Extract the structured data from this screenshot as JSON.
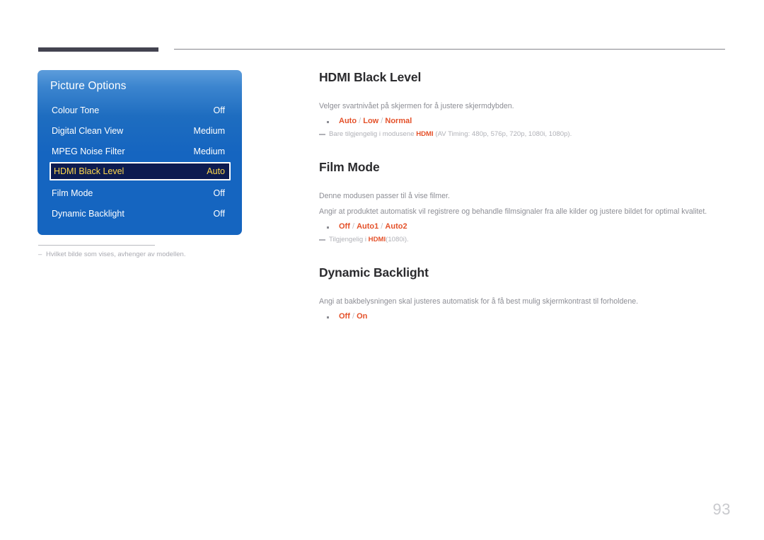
{
  "page": {
    "number": "93",
    "left_footnote": "Hvilket bilde som vises, avhenger av modellen."
  },
  "osd_menu": {
    "title": "Picture Options",
    "rows": [
      {
        "label": "Colour Tone",
        "value": "Off",
        "selected": false
      },
      {
        "label": "Digital Clean View",
        "value": "Medium",
        "selected": false
      },
      {
        "label": "MPEG Noise Filter",
        "value": "Medium",
        "selected": false
      },
      {
        "label": "HDMI Black Level",
        "value": "Auto",
        "selected": true
      },
      {
        "label": "Film Mode",
        "value": "Off",
        "selected": false
      },
      {
        "label": "Dynamic Backlight",
        "value": "Off",
        "selected": false
      }
    ],
    "colors": {
      "panel_blue": "#1565c0",
      "selected_bg": "#0d1b50",
      "selected_text": "#ffd84d"
    }
  },
  "sections": {
    "hdmi_black_level": {
      "heading": "HDMI Black Level",
      "body": "Velger svartnivået på skjermen for å justere skjermdybden.",
      "options": {
        "o1": "Auto",
        "o2": "Low",
        "o3": "Normal"
      },
      "note_pre": "Bare tilgjengelig i modusene ",
      "note_hl": "HDMI",
      "note_post": " (AV Timing: 480p, 576p, 720p, 1080i, 1080p)."
    },
    "film_mode": {
      "heading": "Film Mode",
      "body1": "Denne modusen passer til å vise filmer.",
      "body2": "Angir at produktet automatisk vil registrere og behandle filmsignaler fra alle kilder og justere bildet for optimal kvalitet.",
      "options": {
        "o1": "Off",
        "o2": "Auto1",
        "o3": "Auto2"
      },
      "note_pre": "Tilgjengelig i ",
      "note_hl": "HDMI",
      "note_post": "(1080i)."
    },
    "dynamic_backlight": {
      "heading": "Dynamic Backlight",
      "body": "Angi at bakbelysningen skal justeres automatisk for å få best mulig skjermkontrast til forholdene.",
      "options": {
        "o1": "Off",
        "o2": "On"
      }
    }
  },
  "colors": {
    "accent_orange": "#e4512a",
    "heading_dark": "#2b2b2e",
    "body_gray": "#8d8e95"
  }
}
